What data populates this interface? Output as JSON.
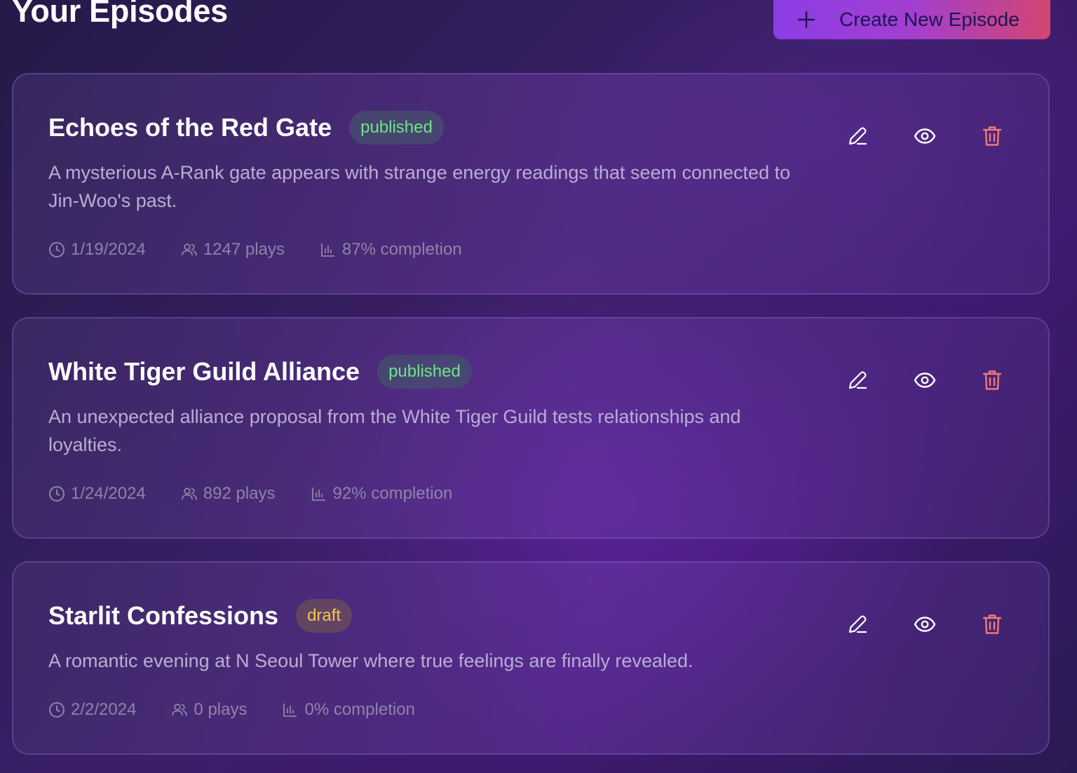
{
  "header": {
    "title": "Your Episodes",
    "create_button_label": "Create New Episode"
  },
  "episodes": [
    {
      "title": "Echoes of the Red Gate",
      "status": "published",
      "description": "A mysterious A-Rank gate appears with strange energy readings that seem connected to Jin-Woo's past.",
      "date": "1/19/2024",
      "plays": "1247 plays",
      "completion": "87% completion"
    },
    {
      "title": "White Tiger Guild Alliance",
      "status": "published",
      "description": "An unexpected alliance proposal from the White Tiger Guild tests relationships and loyalties.",
      "date": "1/24/2024",
      "plays": "892 plays",
      "completion": "92% completion"
    },
    {
      "title": "Starlit Confessions",
      "status": "draft",
      "description": "A romantic evening at N Seoul Tower where true feelings are finally revealed.",
      "date": "2/2/2024",
      "plays": "0 plays",
      "completion": "0% completion"
    }
  ],
  "icons": {
    "create": "plus-icon",
    "edit": "pencil-icon",
    "view": "eye-icon",
    "delete": "trash-icon",
    "date": "clock-icon",
    "plays": "users-icon",
    "completion": "bar-chart-icon"
  },
  "colors": {
    "published_badge_text": "#6ee38a",
    "draft_badge_text": "#f2c84a",
    "delete_icon": "#f07a7a",
    "button_gradient_start": "#8b3ee6",
    "button_gradient_end": "#d2466f"
  }
}
